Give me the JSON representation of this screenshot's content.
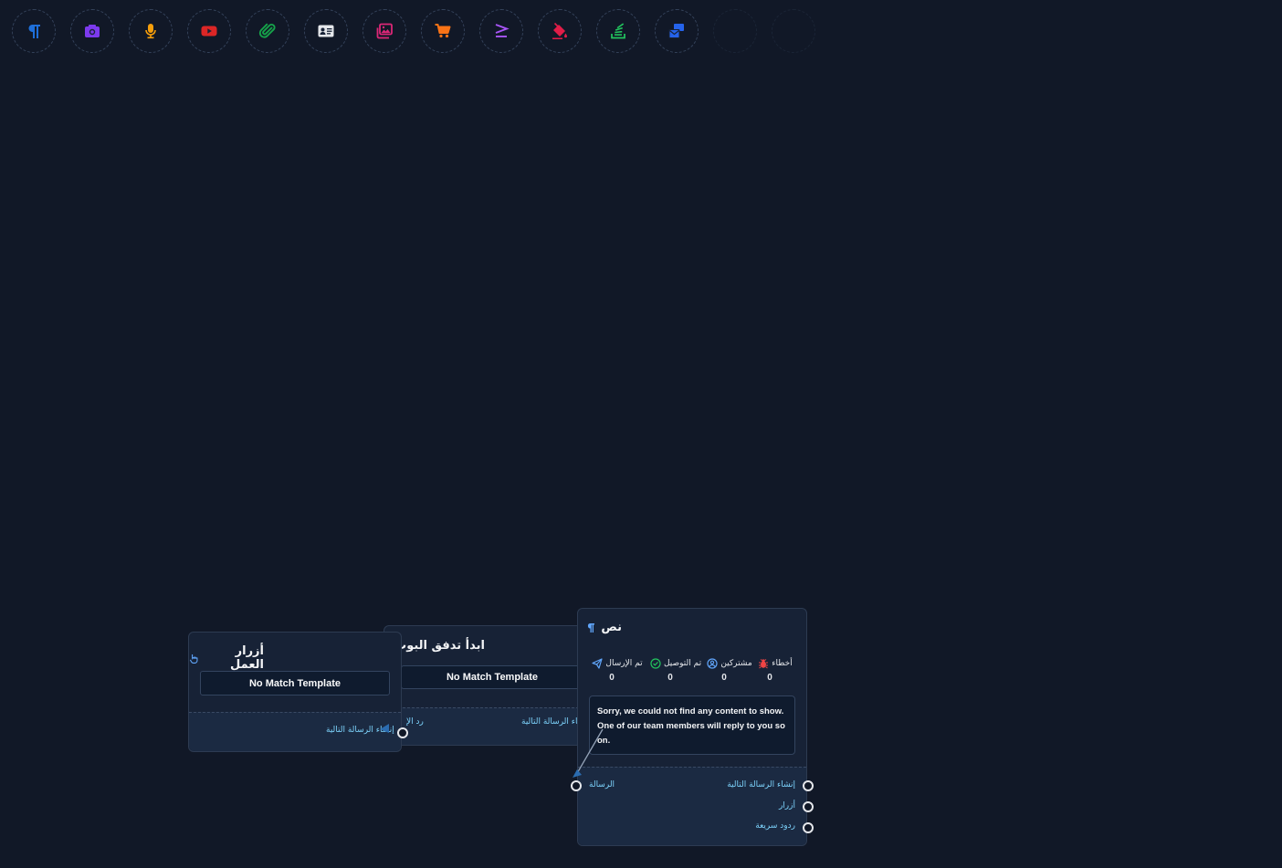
{
  "toolbar": {
    "tools": [
      {
        "icon": "paragraph-icon",
        "color": "#1e6fd9"
      },
      {
        "icon": "camera-icon",
        "color": "#7c3aed"
      },
      {
        "icon": "microphone-icon",
        "color": "#f59e0b"
      },
      {
        "icon": "youtube-icon",
        "color": "#dc2626"
      },
      {
        "icon": "paperclip-icon",
        "color": "#16a34a"
      },
      {
        "icon": "contact-card-icon",
        "color": "#e5e7eb"
      },
      {
        "icon": "images-icon",
        "color": "#db2777"
      },
      {
        "icon": "shopping-cart-icon",
        "color": "#f97316"
      },
      {
        "icon": "greater-equal-icon",
        "color": "#a855f7"
      },
      {
        "icon": "fill-bucket-icon",
        "color": "#e11d48"
      },
      {
        "icon": "stack-icon",
        "color": "#22c55e"
      },
      {
        "icon": "mail-bulk-icon",
        "color": "#2563eb"
      }
    ]
  },
  "nodes": {
    "action_buttons": {
      "title": "أزرار العمل",
      "template_button": "No Match Template",
      "output_label": "إنشاء الرسالة التالية"
    },
    "start_flow": {
      "title": "ابدأ تدفق البوت",
      "template_button": "No Match Template",
      "left_label": "رد الإ",
      "output_label": "إنشاء الرسالة التالية"
    },
    "text": {
      "title": "نص",
      "stats": [
        {
          "label": "تم الإرسال",
          "value": "0",
          "icon": "send-icon",
          "color": "#60a5fa"
        },
        {
          "label": "تم التوصيل",
          "value": "0",
          "icon": "check-circle-icon",
          "color": "#22c55e"
        },
        {
          "label": "مشتركين",
          "value": "0",
          "icon": "user-circle-icon",
          "color": "#60a5fa"
        },
        {
          "label": "أخطاء",
          "value": "0",
          "icon": "bug-icon",
          "color": "#ef4444"
        }
      ],
      "message": "Sorry, we could not find any content to show. One of our team members will reply to you soon.",
      "input_label": "الرسالة",
      "outputs": [
        "إنشاء الرسالة التالية",
        "أزرار",
        "ردود سريعة"
      ]
    }
  }
}
